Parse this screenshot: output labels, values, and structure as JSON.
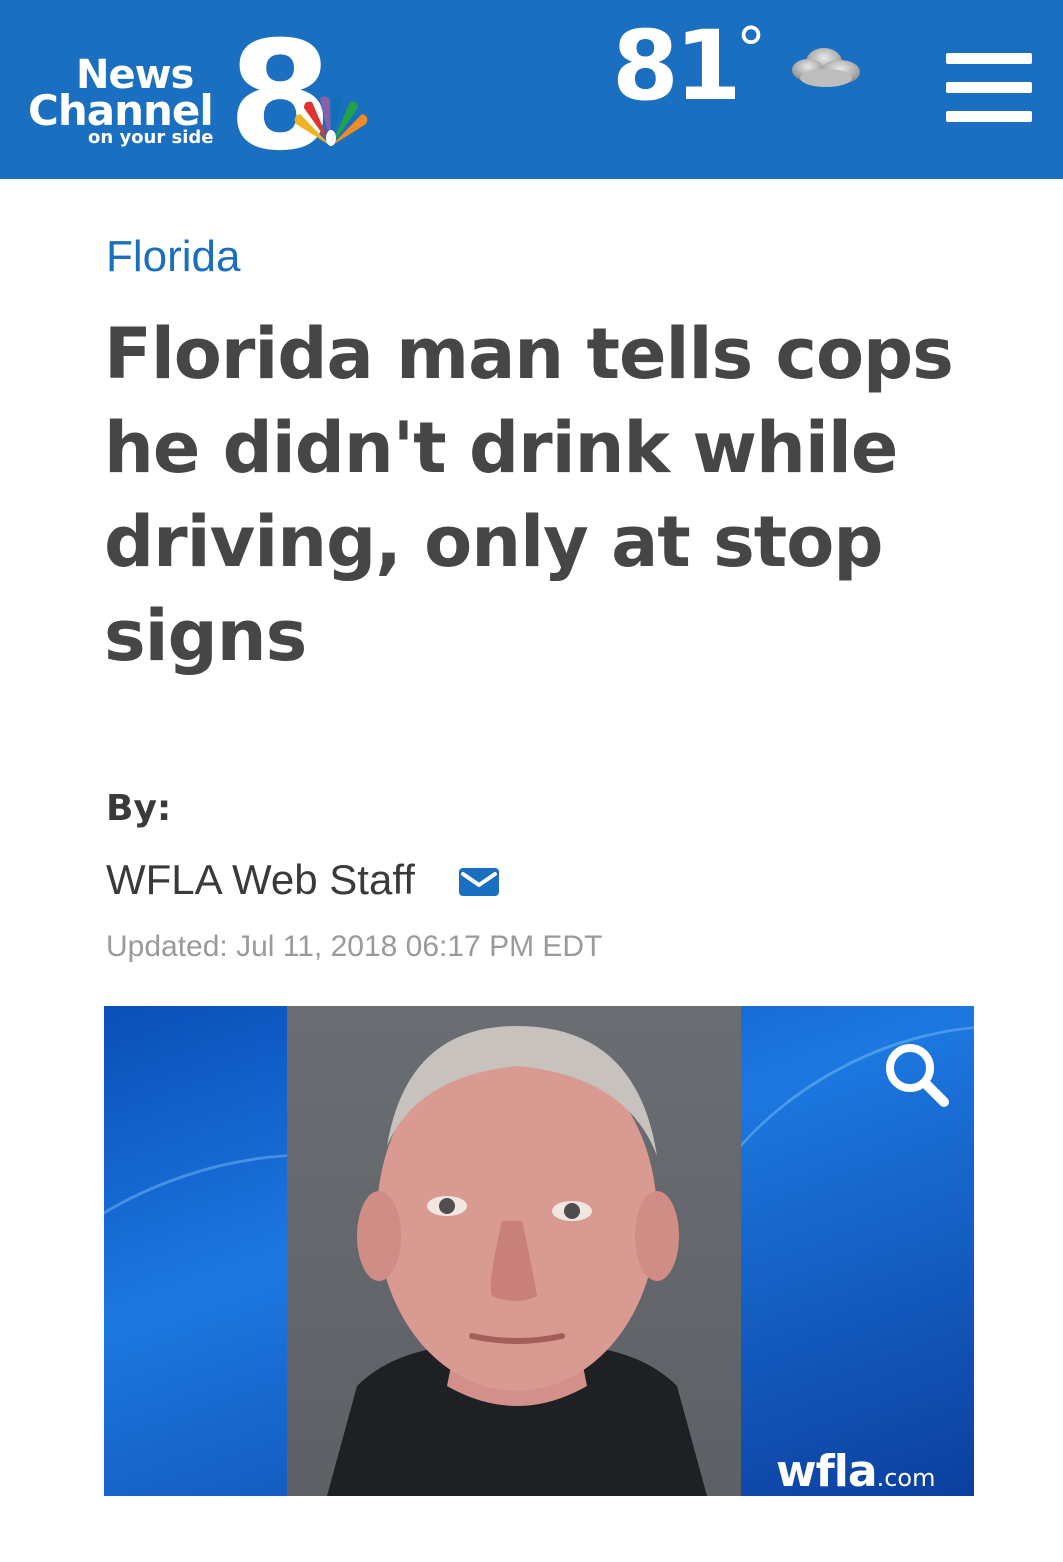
{
  "header": {
    "logo": {
      "line1": "News",
      "line2": "Channel",
      "number": "8",
      "tagline": "on your side"
    },
    "weather": {
      "temperature": "81",
      "degree_symbol": "°",
      "icon": "partly-cloudy-icon"
    },
    "menu_icon": "hamburger-menu-icon"
  },
  "article": {
    "category": "Florida",
    "headline": "Florida man tells cops he didn't drink while driving, only at stop signs",
    "byline_label": "By:",
    "author": "WFLA Web Staff",
    "updated": "Updated: Jul 11, 2018 06:17 PM EDT"
  },
  "photo": {
    "zoom_icon": "magnifier-icon",
    "watermark_main": "wfla",
    "watermark_suffix": ".com"
  },
  "colors": {
    "brand_blue": "#1a6fc0",
    "headline_text": "#464646",
    "meta_text": "#9a9a9a"
  }
}
